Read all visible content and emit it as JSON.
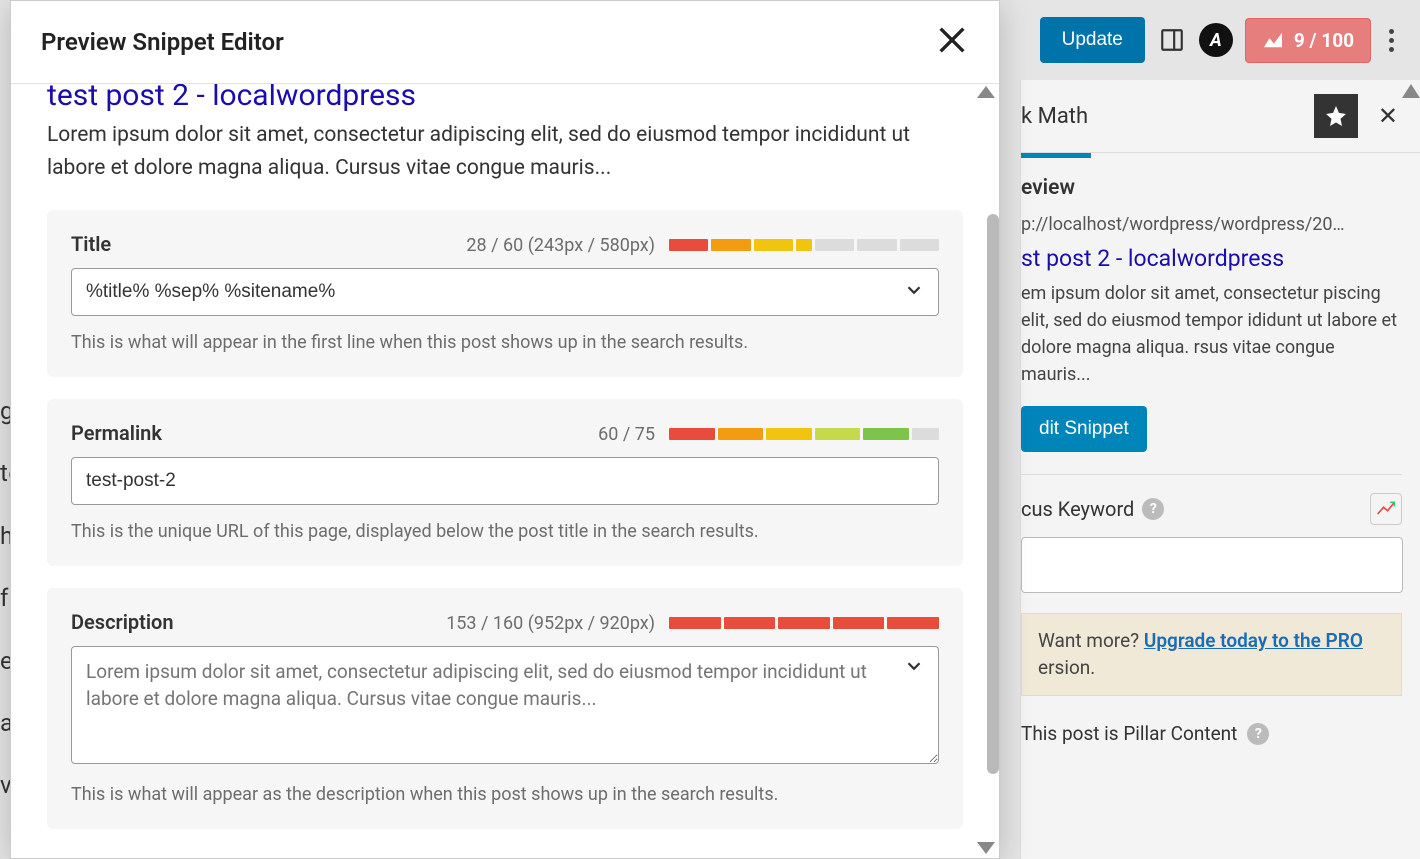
{
  "toolbar": {
    "update_label": "Update",
    "score": "9 / 100"
  },
  "sidebar": {
    "tab_title": "k Math",
    "preview_heading": "eview",
    "url": "p://localhost/wordpress/wordpress/20…",
    "snippet_title": "st post 2 - localwordpress",
    "snippet_desc": "em ipsum dolor sit amet, consectetur piscing elit, sed do eiusmod tempor ididunt ut labore et dolore magna aliqua. rsus vitae congue mauris...",
    "edit_snippet": "dit Snippet",
    "focus_keyword_label": "cus Keyword",
    "upgrade_text_pre": "Want more? ",
    "upgrade_link": "Upgrade today to the PRO",
    "upgrade_text_post": "ersion.",
    "pillar_label": "This post is Pillar Content"
  },
  "modal": {
    "title": "Preview Snippet Editor",
    "preview": {
      "title": "test post 2 - localwordpress",
      "desc": "Lorem ipsum dolor sit amet, consectetur adipiscing elit, sed do eiusmod tempor incididunt ut labore et dolore magna aliqua. Cursus vitae congue mauris..."
    },
    "fields": {
      "title": {
        "label": "Title",
        "count": "28 / 60 (243px / 580px)",
        "value": "%title% %sep% %sitename%",
        "help": "This is what will appear in the first line when this post shows up in the search results."
      },
      "permalink": {
        "label": "Permalink",
        "count": "60 / 75",
        "value": "test-post-2",
        "help": "This is the unique URL of this page, displayed below the post title in the search results."
      },
      "description": {
        "label": "Description",
        "count": "153 / 160 (952px / 920px)",
        "placeholder": "Lorem ipsum dolor sit amet, consectetur adipiscing elit, sed do eiusmod tempor incididunt ut labore et dolore magna aliqua. Cursus vitae congue mauris...",
        "help": "This is what will appear as the description when this post shows up in the search results."
      }
    }
  }
}
